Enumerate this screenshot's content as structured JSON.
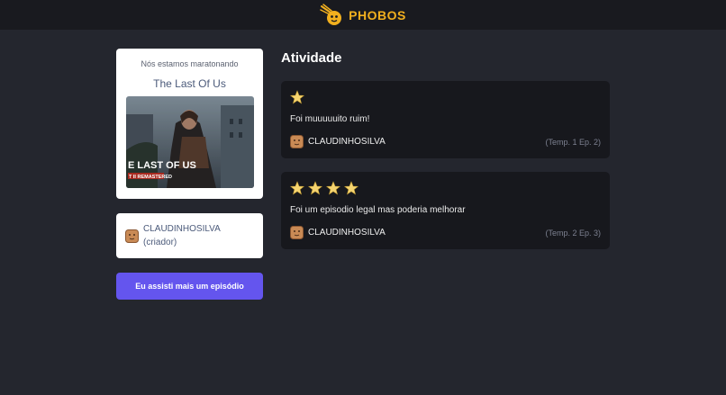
{
  "header": {
    "brand": "PHOBOS",
    "logo_icon": "comet-face-icon",
    "brand_color": "#f2b01e"
  },
  "show_card": {
    "subtitle": "Nós estamos maratonando",
    "title": "The Last Of Us",
    "poster_text_line1": "E LAST OF US",
    "poster_text_line2": "T II  REMASTERED"
  },
  "creator_card": {
    "name": "CLAUDINHOSILVA",
    "role": "(criador)",
    "avatar_icon": "cookie-avatar-icon"
  },
  "watch_button": {
    "label": "Eu assisti mais um episódio",
    "color": "#6455ee"
  },
  "activity": {
    "title": "Atividade",
    "reviews": [
      {
        "rating": 1,
        "text": "Foi muuuuuito ruim!",
        "user": "CLAUDINHOSILVA",
        "episode": "(Temp. 1 Ep. 2)"
      },
      {
        "rating": 4,
        "text": "Foi um episodio legal mas poderia melhorar",
        "user": "CLAUDINHOSILVA",
        "episode": "(Temp. 2 Ep. 3)"
      }
    ]
  },
  "colors": {
    "background": "#24262e",
    "topbar": "#191a1f",
    "card_dark": "#17181d",
    "star": "#f5d470"
  }
}
